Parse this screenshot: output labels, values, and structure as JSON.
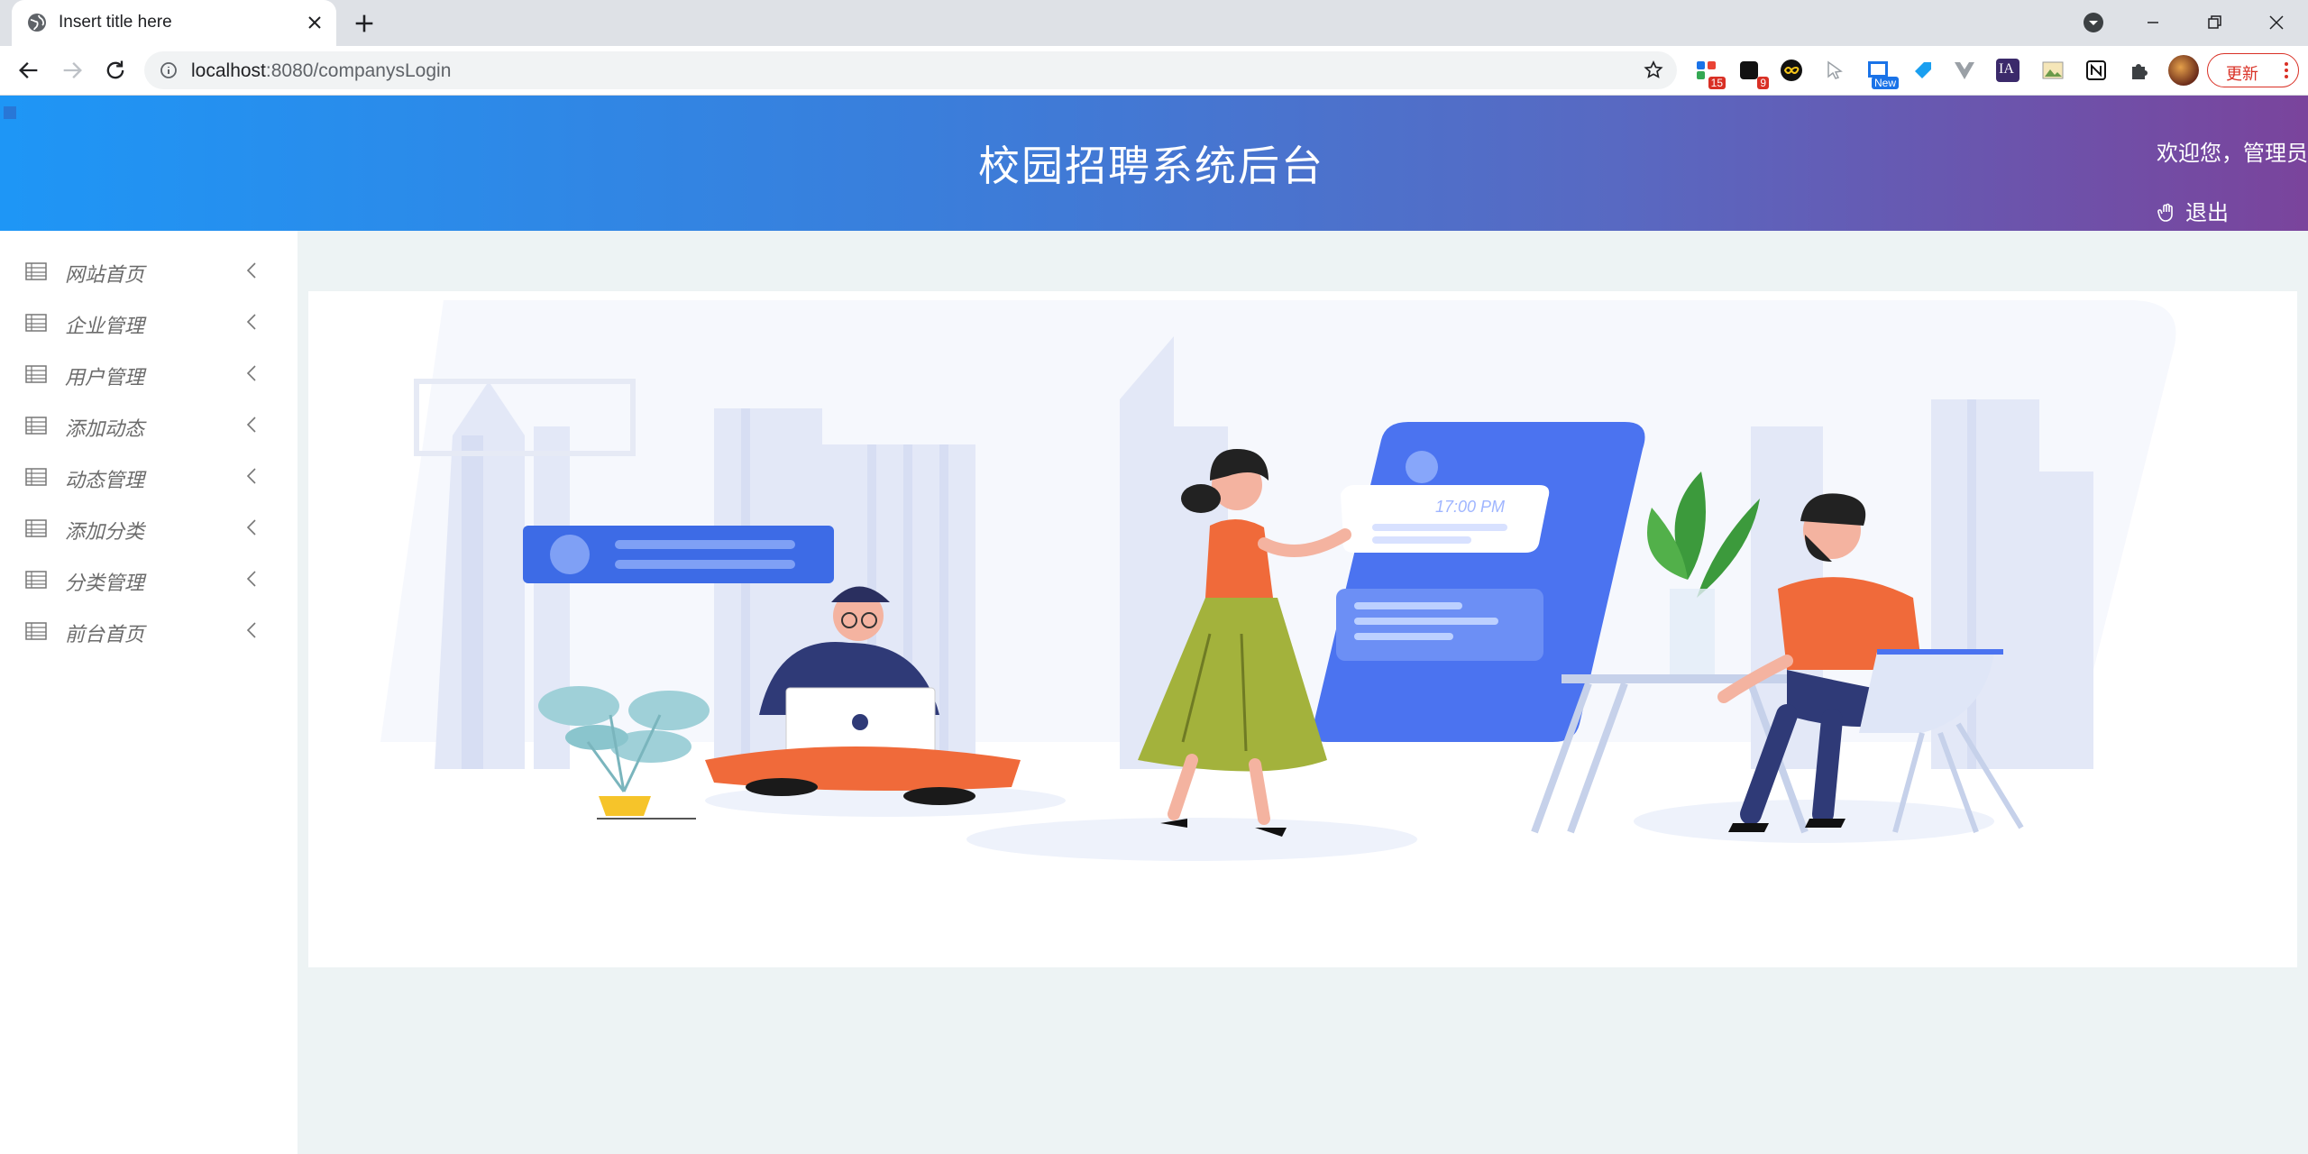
{
  "browser": {
    "tab_title": "Insert title here",
    "url_host": "localhost",
    "url_path": ":8080/companysLogin",
    "extension_badges": {
      "ext1": "15",
      "ext2": "9",
      "ext5": "New",
      "ext9": "IA"
    },
    "update_label": "更新"
  },
  "header": {
    "title": "校园招聘系统后台",
    "welcome": "欢迎您，管理员",
    "logout": "退出"
  },
  "sidebar": {
    "items": [
      {
        "label": "网站首页"
      },
      {
        "label": "企业管理"
      },
      {
        "label": "用户管理"
      },
      {
        "label": "添加动态"
      },
      {
        "label": "动态管理"
      },
      {
        "label": "添加分类"
      },
      {
        "label": "分类管理"
      },
      {
        "label": "前台首页"
      }
    ]
  },
  "banner": {
    "clock_text": "17:00 PM"
  }
}
